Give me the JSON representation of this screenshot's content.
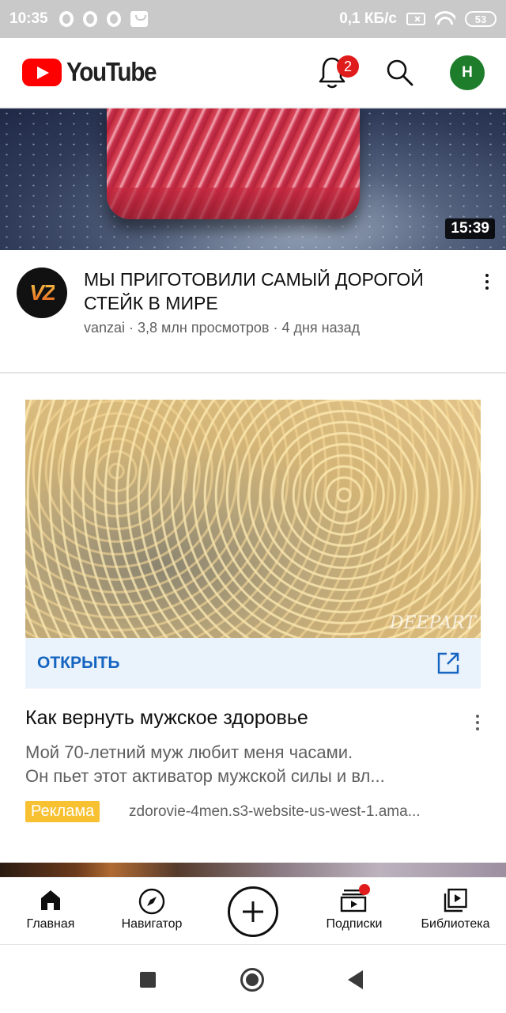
{
  "status_bar": {
    "time": "10:35",
    "net_speed": "0,1 КБ/с",
    "battery": "53"
  },
  "header": {
    "logo_text": "YouTube",
    "notifications_count": "2",
    "avatar_letter": "H",
    "brand_color": "#ff0000"
  },
  "video": {
    "duration": "15:39",
    "channel_logo_text": "VZ",
    "title": "МЫ ПРИГОТОВИЛИ САМЫЙ ДОРОГОЙ СТЕЙК В МИРЕ",
    "meta": "vanzai · 3,8 млн просмотров · 4 дня назад"
  },
  "ad": {
    "image_watermark": "DEEPART",
    "open_label": "ОТКРЫТЬ",
    "title": "Как вернуть мужское здоровье",
    "desc_line1": "Мой 70-летний муж любит меня часами.",
    "desc_line2": "Он пьет этот активатор мужской силы и вл...",
    "badge": "Реклама",
    "url": "zdorovie-4men.s3-website-us-west-1.ama...",
    "badge_color": "#f7c132",
    "link_color": "#1565c0"
  },
  "bottom_nav": {
    "home": "Главная",
    "explore": "Навигатор",
    "subscriptions": "Подписки",
    "library": "Библиотека"
  },
  "icons": [
    "bell-icon",
    "search-icon",
    "home-icon",
    "compass-icon",
    "add-icon",
    "subscriptions-icon",
    "library-icon",
    "external-link-icon",
    "more-vert-icon"
  ]
}
